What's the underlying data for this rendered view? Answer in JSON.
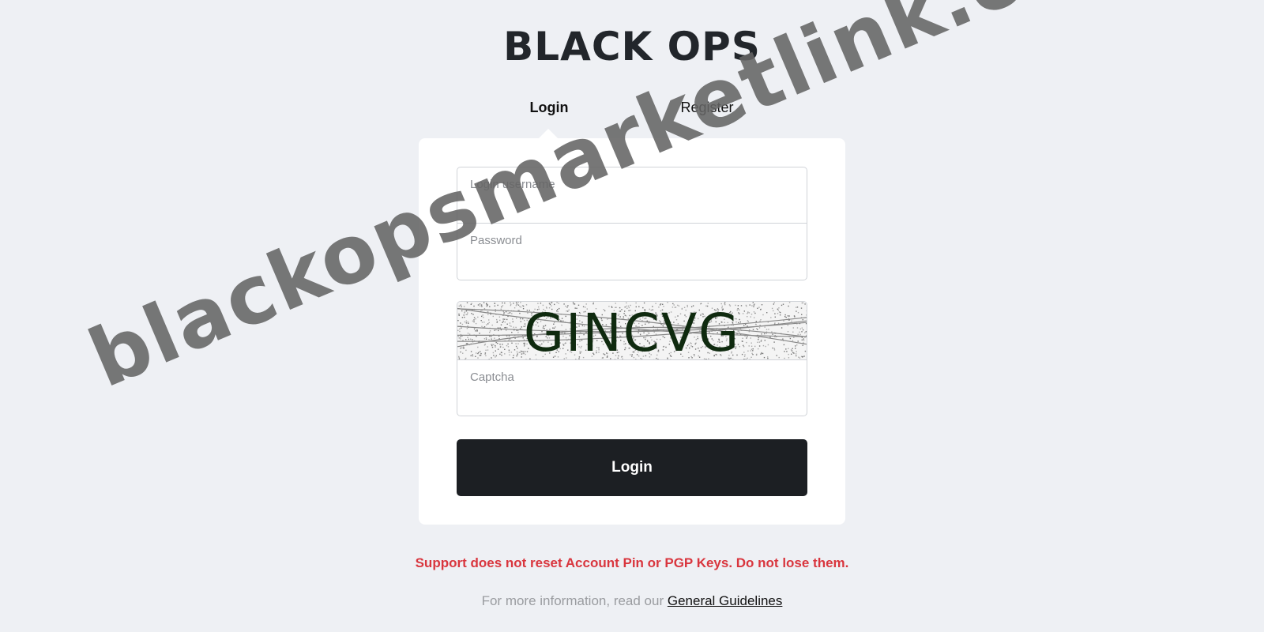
{
  "brand": {
    "logo_text": "BLACK OPS"
  },
  "tabs": [
    {
      "label": "Login",
      "active": true
    },
    {
      "label": "Register",
      "active": false
    }
  ],
  "form": {
    "username_placeholder": "Login username",
    "password_placeholder": "Password",
    "captcha_text": "GINCVG",
    "captcha_placeholder": "Captcha",
    "submit_label": "Login"
  },
  "notice": {
    "warning": "Support does not reset Account Pin or PGP Keys. Do not lose them.",
    "info_prefix": "For more information, read our ",
    "info_link": "General Guidelines"
  },
  "watermark": "blackopsmarketlink.online",
  "colors": {
    "background": "#eef0f4",
    "button": "#1c1f23",
    "warning": "#d9363e",
    "captcha_text": "#0f2a0f"
  }
}
